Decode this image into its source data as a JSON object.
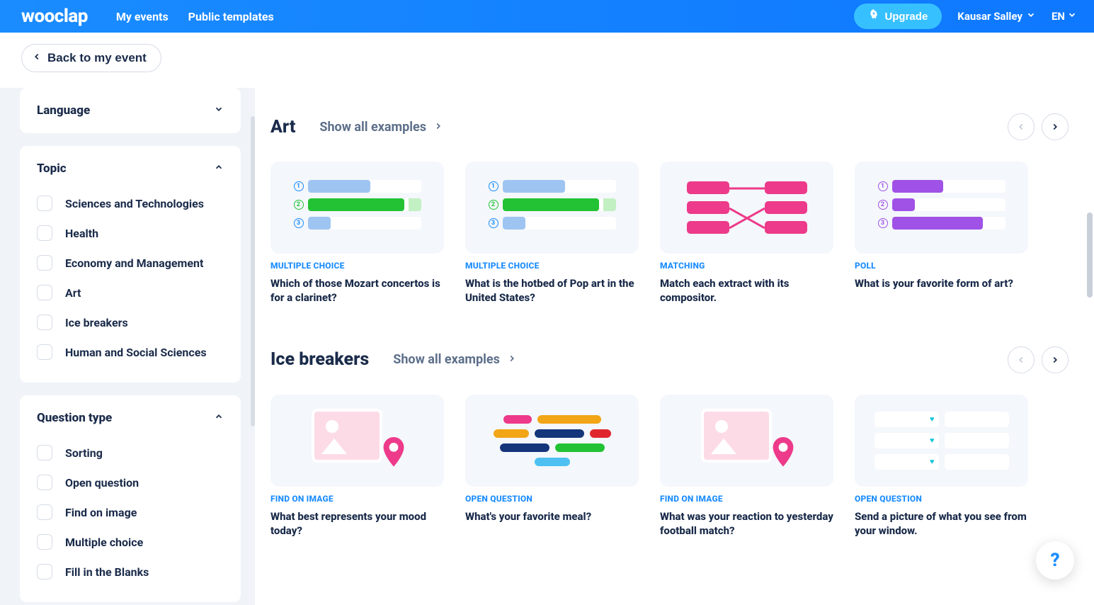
{
  "topbar": {
    "logo": "wooclap",
    "nav": [
      "My events",
      "Public templates"
    ],
    "upgrade": "Upgrade",
    "user": "Kausar Salley",
    "lang": "EN"
  },
  "back_button": "Back to my event",
  "sidebar": {
    "panels": [
      {
        "title": "Language",
        "expanded": false,
        "items": []
      },
      {
        "title": "Topic",
        "expanded": true,
        "items": [
          "Sciences and Technologies",
          "Health",
          "Economy and Management",
          "Art",
          "Ice breakers",
          "Human and Social Sciences"
        ]
      },
      {
        "title": "Question type",
        "expanded": true,
        "items": [
          "Sorting",
          "Open question",
          "Find on image",
          "Multiple choice",
          "Fill in the Blanks"
        ]
      }
    ]
  },
  "sections": [
    {
      "title": "Art",
      "show_all": "Show all examples",
      "prev_disabled": true,
      "cards": [
        {
          "thumb": "mc",
          "tag": "MULTIPLE CHOICE",
          "title": "Which of those Mozart concertos is for a clarinet?"
        },
        {
          "thumb": "mc",
          "tag": "MULTIPLE CHOICE",
          "title": "What is the hotbed of Pop art in the United States?"
        },
        {
          "thumb": "match",
          "tag": "MATCHING",
          "title": "Match each extract with its compositor."
        },
        {
          "thumb": "poll",
          "tag": "POLL",
          "title": "What is your favorite form of art?"
        }
      ]
    },
    {
      "title": "Ice breakers",
      "show_all": "Show all examples",
      "prev_disabled": true,
      "cards": [
        {
          "thumb": "foi",
          "tag": "FIND ON IMAGE",
          "title": "What best represents your mood today?"
        },
        {
          "thumb": "oq",
          "tag": "OPEN QUESTION",
          "title": "What's your favorite meal?"
        },
        {
          "thumb": "foi",
          "tag": "FIND ON IMAGE",
          "title": "What was your reaction to yesterday football match?"
        },
        {
          "thumb": "wc",
          "tag": "OPEN QUESTION",
          "title": "Send a picture of what you see from your window."
        }
      ]
    }
  ],
  "help": "?"
}
